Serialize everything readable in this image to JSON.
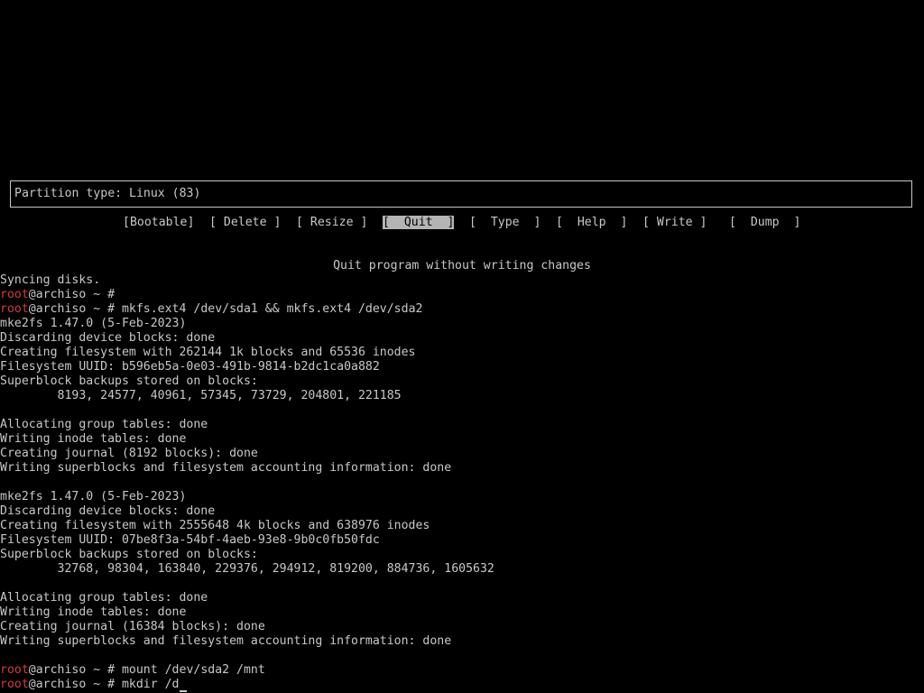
{
  "fdisk": {
    "partition_type_label": "Partition type: Linux (83)",
    "menu": [
      "[Bootable]",
      "[ Delete ]",
      "[ Resize ]",
      "[  Quit  ]",
      "[  Type  ]",
      "[  Help  ]",
      "[ Write ]",
      "[  Dump  ]"
    ],
    "selected_menu_index": 3,
    "hint": "Quit program without writing changes"
  },
  "terminal": {
    "prompt_user": "root",
    "prompt_rest": "@archiso ~ # ",
    "lines": [
      {
        "type": "text",
        "text": "Syncing disks."
      },
      {
        "type": "prompt",
        "cmd": ""
      },
      {
        "type": "prompt",
        "cmd": "mkfs.ext4 /dev/sda1 && mkfs.ext4 /dev/sda2"
      },
      {
        "type": "text",
        "text": "mke2fs 1.47.0 (5-Feb-2023)"
      },
      {
        "type": "text",
        "text": "Discarding device blocks: done"
      },
      {
        "type": "text",
        "text": "Creating filesystem with 262144 1k blocks and 65536 inodes"
      },
      {
        "type": "text",
        "text": "Filesystem UUID: b596eb5a-0e03-491b-9814-b2dc1ca0a882"
      },
      {
        "type": "text",
        "text": "Superblock backups stored on blocks:"
      },
      {
        "type": "text",
        "text": "        8193, 24577, 40961, 57345, 73729, 204801, 221185"
      },
      {
        "type": "text",
        "text": ""
      },
      {
        "type": "text",
        "text": "Allocating group tables: done"
      },
      {
        "type": "text",
        "text": "Writing inode tables: done"
      },
      {
        "type": "text",
        "text": "Creating journal (8192 blocks): done"
      },
      {
        "type": "text",
        "text": "Writing superblocks and filesystem accounting information: done"
      },
      {
        "type": "text",
        "text": ""
      },
      {
        "type": "text",
        "text": "mke2fs 1.47.0 (5-Feb-2023)"
      },
      {
        "type": "text",
        "text": "Discarding device blocks: done"
      },
      {
        "type": "text",
        "text": "Creating filesystem with 2555648 4k blocks and 638976 inodes"
      },
      {
        "type": "text",
        "text": "Filesystem UUID: 07be8f3a-54bf-4aeb-93e8-9b0c0fb50fdc"
      },
      {
        "type": "text",
        "text": "Superblock backups stored on blocks:"
      },
      {
        "type": "text",
        "text": "        32768, 98304, 163840, 229376, 294912, 819200, 884736, 1605632"
      },
      {
        "type": "text",
        "text": ""
      },
      {
        "type": "text",
        "text": "Allocating group tables: done"
      },
      {
        "type": "text",
        "text": "Writing inode tables: done"
      },
      {
        "type": "text",
        "text": "Creating journal (16384 blocks): done"
      },
      {
        "type": "text",
        "text": "Writing superblocks and filesystem accounting information: done"
      },
      {
        "type": "text",
        "text": ""
      },
      {
        "type": "prompt",
        "cmd": "mount /dev/sda2 /mnt"
      },
      {
        "type": "prompt",
        "cmd": "mkdir /d",
        "cursor": true
      }
    ]
  }
}
